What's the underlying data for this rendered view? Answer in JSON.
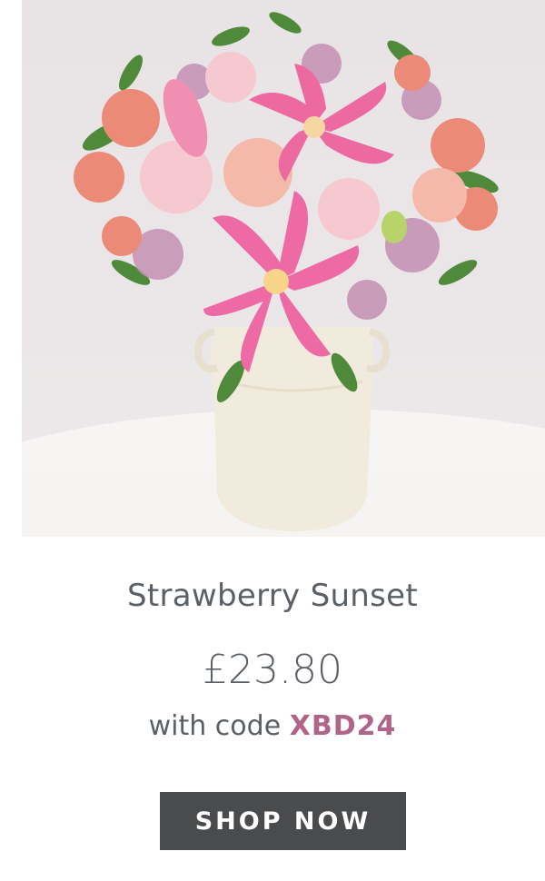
{
  "product": {
    "name": "Strawberry Sunset",
    "price": "£23.80",
    "code_prefix": "with code",
    "code": "XBD24",
    "cta_label": "SHOP NOW"
  },
  "colors": {
    "text": "#5b6068",
    "code": "#b0648a",
    "button": "#4a4b4d"
  }
}
